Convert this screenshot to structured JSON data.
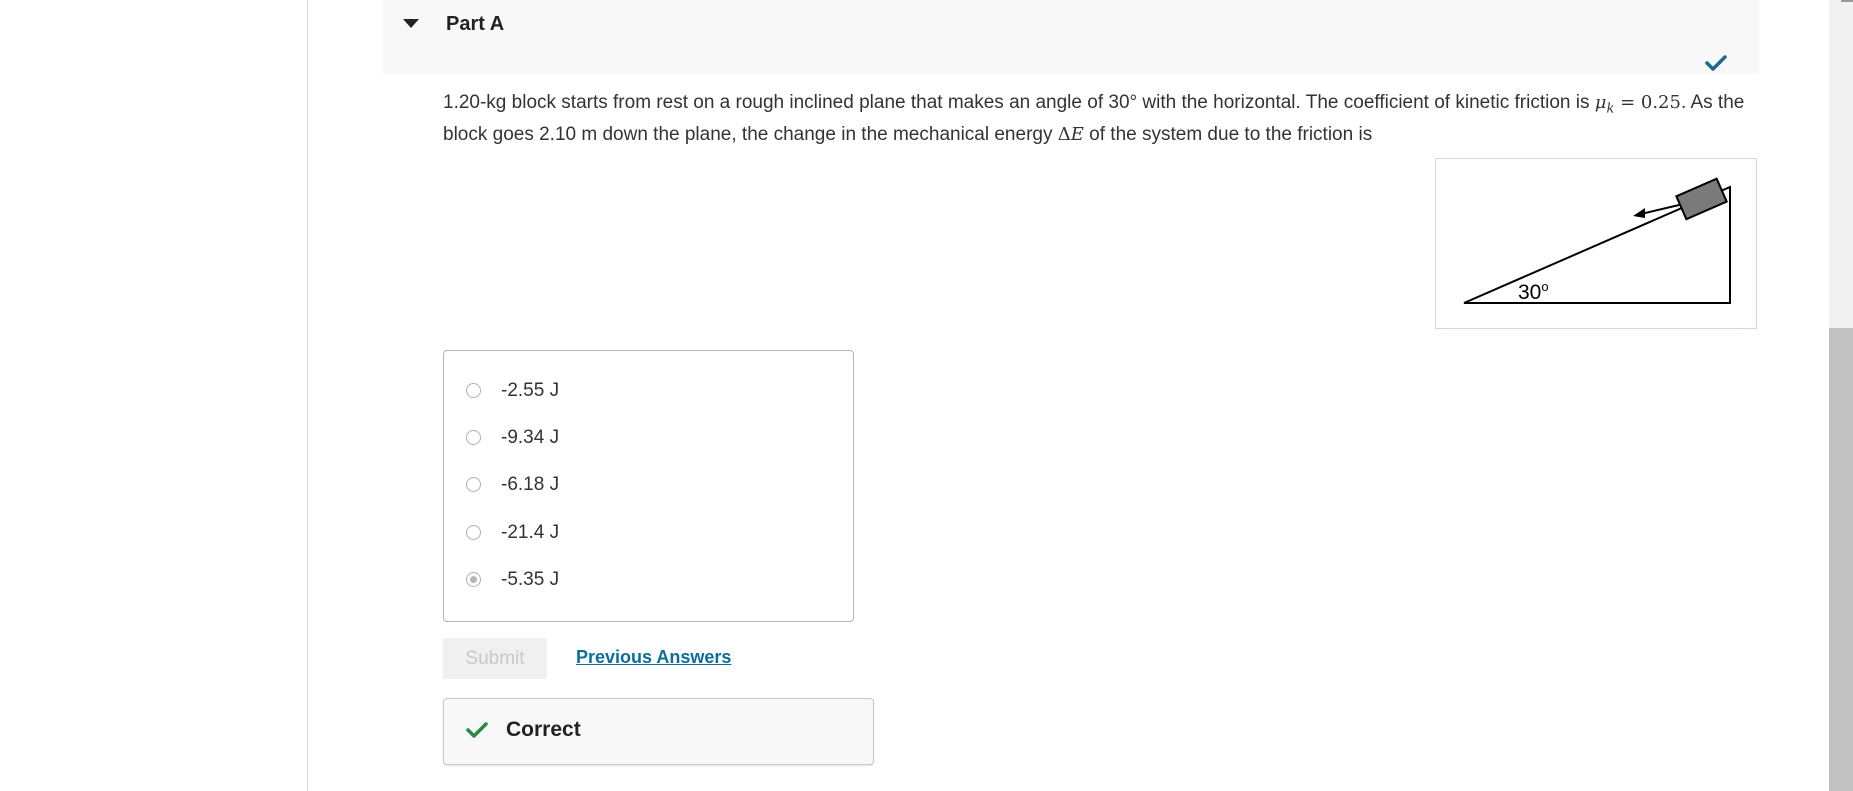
{
  "part": {
    "title": "Part A",
    "status": "correct"
  },
  "question": {
    "text_before_mu": "1.20-kg block starts from rest on a rough inclined plane that makes an angle of 30° with the horizontal. The coefficient of kinetic friction is ",
    "mu_symbol": "μ",
    "mu_subscript": "k",
    "mu_equals": " = 0.25",
    "text_after_mu": ". As the block goes 2.10 m down the plane, the change in the mechanical energy ",
    "delta_symbol": "Δ",
    "energy_symbol": "E",
    "text_end": " of the system due to the friction is"
  },
  "figure": {
    "angle_label": "30",
    "angle_unit": "o",
    "ramp_color": "#000000",
    "block_color": "#7a7a7a"
  },
  "options": [
    {
      "label": "-2.55 J",
      "selected": false
    },
    {
      "label": "-9.34 J",
      "selected": false
    },
    {
      "label": "-6.18 J",
      "selected": false
    },
    {
      "label": "-21.4 J",
      "selected": false
    },
    {
      "label": "-5.35 J",
      "selected": true
    }
  ],
  "actions": {
    "submit_label": "Submit",
    "previous_answers_label": "Previous Answers"
  },
  "feedback": {
    "label": "Correct"
  },
  "colors": {
    "check_blue": "#1d6a8c",
    "check_green": "#2a8a3e",
    "link": "#0e6e9a"
  }
}
